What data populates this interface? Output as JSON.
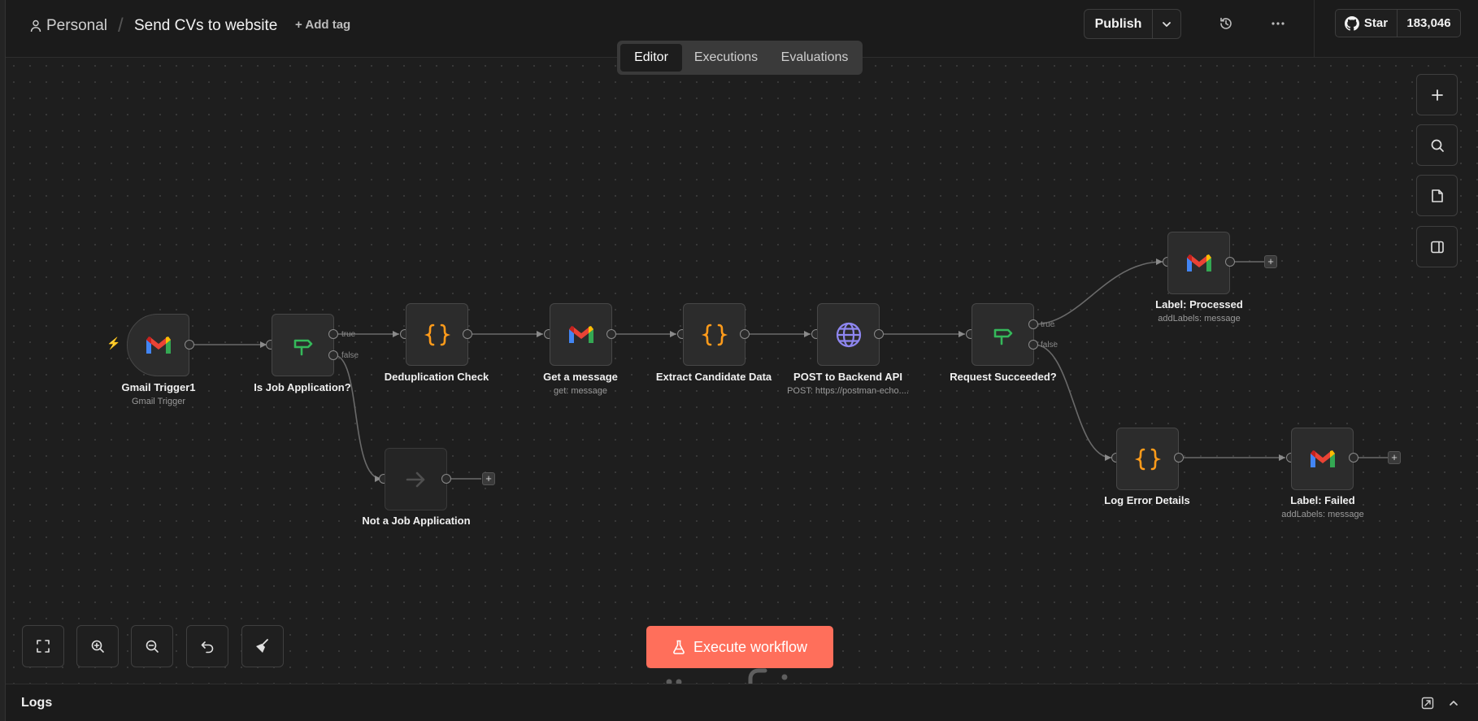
{
  "header": {
    "project": "Personal",
    "separator": "/",
    "workflow_title": "Send CVs to website",
    "add_tag": "+ Add tag",
    "publish": "Publish",
    "github_star": "Star",
    "star_count": "183,046"
  },
  "tabs": [
    {
      "label": "Editor",
      "active": true
    },
    {
      "label": "Executions",
      "active": false
    },
    {
      "label": "Evaluations",
      "active": false
    }
  ],
  "nodes": {
    "gmail_trigger": {
      "label": "Gmail Trigger1",
      "sub": "Gmail Trigger",
      "icon": "gmail-icon"
    },
    "is_job": {
      "label": "Is Job Application?",
      "icon": "if-signpost-icon"
    },
    "dedup": {
      "label": "Deduplication Check",
      "icon": "code-braces-icon"
    },
    "get_message": {
      "label": "Get a message",
      "sub": "get: message",
      "icon": "gmail-icon"
    },
    "extract": {
      "label": "Extract Candidate Data",
      "icon": "code-braces-icon"
    },
    "post": {
      "label": "POST to Backend API",
      "sub": "POST: https://postman-echo....",
      "icon": "globe-icon"
    },
    "request_ok": {
      "label": "Request Succeeded?",
      "icon": "if-signpost-icon"
    },
    "label_processed": {
      "label": "Label: Processed",
      "sub": "addLabels: message",
      "icon": "gmail-icon"
    },
    "log_error": {
      "label": "Log Error Details",
      "icon": "code-braces-icon"
    },
    "label_failed": {
      "label": "Label: Failed",
      "sub": "addLabels: message",
      "icon": "gmail-icon"
    },
    "not_job": {
      "label": "Not a Job Application",
      "icon": "arrow-right-icon"
    }
  },
  "branches": {
    "true": "true",
    "false": "false"
  },
  "plus": "+",
  "execute_button": "Execute workflow",
  "logs": {
    "title": "Logs"
  },
  "colors": {
    "accent": "#ff6f5b",
    "if_green": "#35b85a",
    "code_orange": "#ff9b1a",
    "globe_purple": "#8f87f1",
    "background": "#1e1e1e"
  }
}
